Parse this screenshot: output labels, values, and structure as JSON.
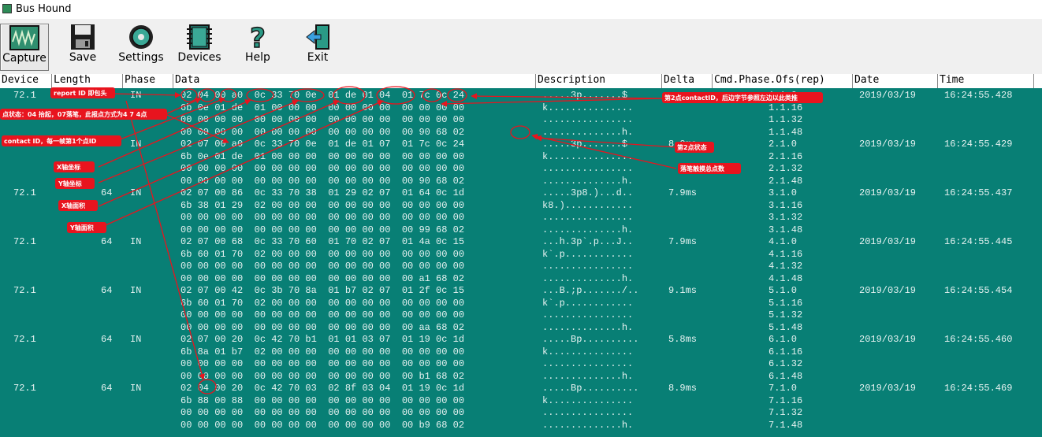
{
  "window": {
    "title": "Bus Hound"
  },
  "toolbar": {
    "capture": "Capture",
    "save": "Save",
    "settings": "Settings",
    "devices": "Devices",
    "help": "Help",
    "exit": "Exit"
  },
  "columns": {
    "device": "Device",
    "length": "Length",
    "phase": "Phase",
    "data": "Data",
    "description": "Description",
    "delta": "Delta",
    "cmd": "Cmd.Phase.Ofs(rep)",
    "date": "Date",
    "time": "Time"
  },
  "records": [
    {
      "device": "72.1",
      "length": "64",
      "phase": "IN",
      "data": [
        "02 04 00 a0  0c 33 70 0e  01 de 01 04  01 7c 0c 24",
        "6b 0e 01 de  01 00 00 00  00 00 00 00  00 00 00 00",
        "00 00 00 00  00 00 00 00  00 00 00 00  00 00 00 00",
        "00 00 00 00  00 00 00 00  00 00 00 00  00 90 68 02"
      ],
      "desc": [
        ".....3p.......$",
        "k...............",
        "................",
        "..............h."
      ],
      "delta": "",
      "cmd": [
        "1.1.0",
        "1.1.16",
        "1.1.32",
        "1.1.48"
      ],
      "date": "2019/03/19",
      "time": "16:24:55.428"
    },
    {
      "device": "72.1",
      "length": "64",
      "phase": "IN",
      "data": [
        "02 07 00 a0  0c 33 70 0e  01 de 01 07  01 7c 0c 24",
        "6b 0e 01 de  01 00 00 00  00 00 00 00  00 00 00 00",
        "00 00 00 00  00 00 00 00  00 00 00 00  00 00 00 00",
        "00 00 00 00  00 00 00 00  00 00 00 00  00 90 68 02"
      ],
      "desc": [
        ".....3p.......$",
        "k...............",
        "................",
        "..............h."
      ],
      "delta": "8.0ms",
      "cmd": [
        "2.1.0",
        "2.1.16",
        "2.1.32",
        "2.1.48"
      ],
      "date": "2019/03/19",
      "time": "16:24:55.429"
    },
    {
      "device": "72.1",
      "length": "64",
      "phase": "IN",
      "data": [
        "02 07 00 86  0c 33 70 38  01 29 02 07  01 64 0c 1d",
        "6b 38 01 29  02 00 00 00  00 00 00 00  00 00 00 00",
        "00 00 00 00  00 00 00 00  00 00 00 00  00 00 00 00",
        "00 00 00 00  00 00 00 00  00 00 00 00  00 99 68 02"
      ],
      "desc": [
        ".....3p8.)...d..",
        "k8.)............",
        "................",
        "..............h."
      ],
      "delta": "7.9ms",
      "cmd": [
        "3.1.0",
        "3.1.16",
        "3.1.32",
        "3.1.48"
      ],
      "date": "2019/03/19",
      "time": "16:24:55.437"
    },
    {
      "device": "72.1",
      "length": "64",
      "phase": "IN",
      "data": [
        "02 07 00 68  0c 33 70 60  01 70 02 07  01 4a 0c 15",
        "6b 60 01 70  02 00 00 00  00 00 00 00  00 00 00 00",
        "00 00 00 00  00 00 00 00  00 00 00 00  00 00 00 00",
        "00 00 00 00  00 00 00 00  00 00 00 00  00 a1 68 02"
      ],
      "desc": [
        "...h.3p`.p...J..",
        "k`.p............",
        "................",
        "..............h."
      ],
      "delta": "7.9ms",
      "cmd": [
        "4.1.0",
        "4.1.16",
        "4.1.32",
        "4.1.48"
      ],
      "date": "2019/03/19",
      "time": "16:24:55.445"
    },
    {
      "device": "72.1",
      "length": "64",
      "phase": "IN",
      "data": [
        "02 07 00 42  0c 3b 70 8a  01 b7 02 07  01 2f 0c 15",
        "6b 60 01 70  02 00 00 00  00 00 00 00  00 00 00 00",
        "00 00 00 00  00 00 00 00  00 00 00 00  00 00 00 00",
        "00 00 00 00  00 00 00 00  00 00 00 00  00 aa 68 02"
      ],
      "desc": [
        "...B.;p......./..",
        "k`.p............",
        "................",
        "..............h."
      ],
      "delta": "9.1ms",
      "cmd": [
        "5.1.0",
        "5.1.16",
        "5.1.32",
        "5.1.48"
      ],
      "date": "2019/03/19",
      "time": "16:24:55.454"
    },
    {
      "device": "72.1",
      "length": "64",
      "phase": "IN",
      "data": [
        "02 07 00 20  0c 42 70 b1  01 01 03 07  01 19 0c 1d",
        "6b 8a 01 b7  02 00 00 00  00 00 00 00  00 00 00 00",
        "00 00 00 00  00 00 00 00  00 00 00 00  00 00 00 00",
        "00 00 00 00  00 00 00 00  00 00 00 00  00 b1 68 02"
      ],
      "desc": [
        ".....Bp..........",
        "k...............",
        "................",
        "..............h."
      ],
      "delta": "5.8ms",
      "cmd": [
        "6.1.0",
        "6.1.16",
        "6.1.32",
        "6.1.48"
      ],
      "date": "2019/03/19",
      "time": "16:24:55.460"
    },
    {
      "device": "72.1",
      "length": "64",
      "phase": "IN",
      "data": [
        "02 04 00 20  0c 42 70 03  02 8f 03 04  01 19 0c 1d",
        "6b 88 00 88  00 00 00 00  00 00 00 00  00 00 00 00",
        "00 00 00 00  00 00 00 00  00 00 00 00  00 00 00 00",
        "00 00 00 00  00 00 00 00  00 00 00 00  00 b9 68 02"
      ],
      "desc": [
        ".....Bp..........",
        "k...............",
        "................",
        "..............h."
      ],
      "delta": "8.9ms",
      "cmd": [
        "7.1.0",
        "7.1.16",
        "7.1.32",
        "7.1.48"
      ],
      "date": "2019/03/19",
      "time": "16:24:55.469"
    }
  ],
  "annotations": {
    "report_id": "report ID 即包头",
    "point_state": "点状态：04 抬起，07落笔，此报点方式为4 7 4点",
    "contact_id": "contact ID，每一帧第1个点ID",
    "x_coord": "X轴坐标",
    "y_coord": "Y轴坐标",
    "x_area": "X轴面积",
    "y_area": "Y轴面积",
    "second_contact": "第2点contactID，后边字节参照左边以此类推",
    "second_state": "第2点状态",
    "total_points": "落笔触摸总点数"
  },
  "colors": {
    "grid_bg": "#087f75",
    "grid_text": "#e6f2f1",
    "annotation": "#e8141e"
  }
}
